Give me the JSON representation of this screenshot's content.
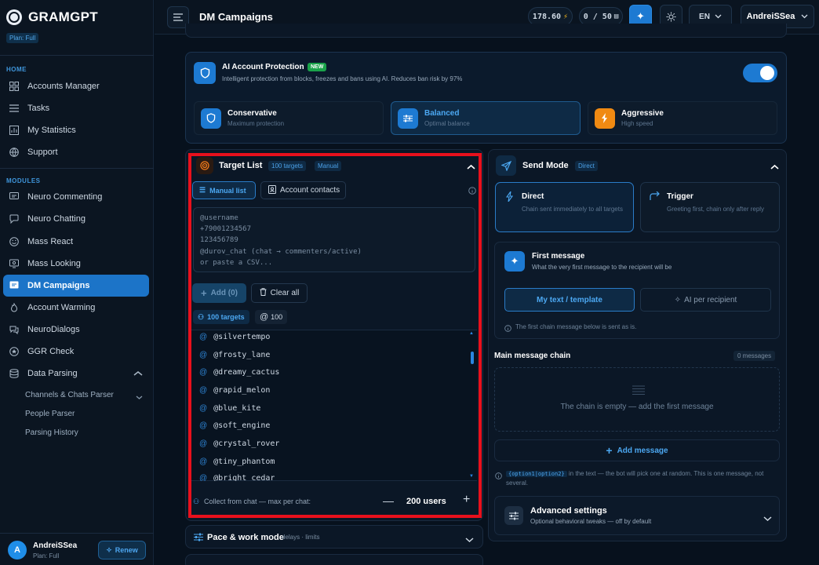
{
  "app": {
    "logo": "GRAMGPT",
    "plan_badge": "Plan: Full"
  },
  "sidebar": {
    "home_label": "HOME",
    "modules_label": "MODULES",
    "home_items": [
      {
        "label": "Accounts Manager",
        "icon": "grid-icon"
      },
      {
        "label": "Tasks",
        "icon": "list-icon"
      },
      {
        "label": "My Statistics",
        "icon": "chart-icon"
      },
      {
        "label": "Support",
        "icon": "globe-icon"
      }
    ],
    "module_items": [
      {
        "label": "Neuro Commenting",
        "icon": "comment-icon"
      },
      {
        "label": "Neuro Chatting",
        "icon": "chat-icon"
      },
      {
        "label": "Mass React",
        "icon": "smile-icon"
      },
      {
        "label": "Mass Looking",
        "icon": "eye-icon"
      },
      {
        "label": "DM Campaigns",
        "icon": "dm-icon",
        "active": true
      },
      {
        "label": "Account Warming",
        "icon": "flame-icon"
      },
      {
        "label": "NeuroDialogs",
        "icon": "dialogs-icon"
      },
      {
        "label": "GGR Check",
        "icon": "check-icon"
      },
      {
        "label": "Data Parsing",
        "icon": "database-icon"
      }
    ],
    "sub_items": [
      "Channels & Chats Parser",
      "People Parser",
      "Parsing History"
    ],
    "user": {
      "initial": "A",
      "name": "AndreiSSea",
      "plan": "Plan: Full",
      "renew": "Renew"
    }
  },
  "header": {
    "title": "DM Campaigns",
    "balance": "178.60",
    "counter": "0 / 50",
    "language": "EN",
    "username": "AndreiSSea"
  },
  "protection": {
    "title": "AI Account Protection",
    "badge": "NEW",
    "desc": "Intelligent protection from blocks, freezes and bans using AI. Reduces ban risk by 97%",
    "toggle_on": true,
    "modes": [
      {
        "title": "Conservative",
        "sub": "Maximum protection"
      },
      {
        "title": "Balanced",
        "sub": "Optimal balance"
      },
      {
        "title": "Aggressive",
        "sub": "High speed"
      }
    ]
  },
  "target_list": {
    "title": "Target List",
    "count_tag": "100 targets",
    "mode_tag": "Manual",
    "tab_manual": "Manual list",
    "tab_contacts": "Account contacts",
    "placeholder_lines": [
      "@username",
      "+79001234567",
      "123456789",
      "@durov_chat (chat → commenters/active)",
      "or paste a CSV..."
    ],
    "add_button": "Add (0)",
    "clear_button": "Clear all",
    "targets_chip": "100 targets",
    "at_chip": "100",
    "targets": [
      "@silvertempo",
      "@frosty_lane",
      "@dreamy_cactus",
      "@rapid_melon",
      "@blue_kite",
      "@soft_engine",
      "@crystal_rover",
      "@tiny_phantom",
      "@bright_cedar"
    ],
    "collect_label": "Collect from chat — max per chat:",
    "collect_value": "200 users"
  },
  "pace": {
    "title": "Pace & work mode",
    "sub": "delays · limits"
  },
  "send_mode": {
    "title": "Send Mode",
    "tag": "Direct",
    "direct_title": "Direct",
    "direct_sub": "Chain sent immediately to all targets",
    "trigger_title": "Trigger",
    "trigger_sub": "Greeting first, chain only after reply",
    "first_msg_title": "First message",
    "first_msg_sub": "What the very first message to the recipient will be",
    "tab_template": "My text / template",
    "tab_ai": "AI per recipient",
    "first_msg_note": "The first chain message below is sent as is.",
    "chain_title": "Main message chain",
    "chain_count": "0 messages",
    "chain_empty": "The chain is empty — add the first message",
    "add_message": "Add message",
    "hint_code": "{option1|option2}",
    "hint_text": "in the text — the bot will pick one at random. This is one message, not several.",
    "advanced_title": "Advanced settings",
    "advanced_sub": "Optional behavioral tweaks — off by default"
  },
  "colors": {
    "accent": "#1c74c8",
    "highlight": "#e8101c",
    "bg": "#07111d"
  }
}
